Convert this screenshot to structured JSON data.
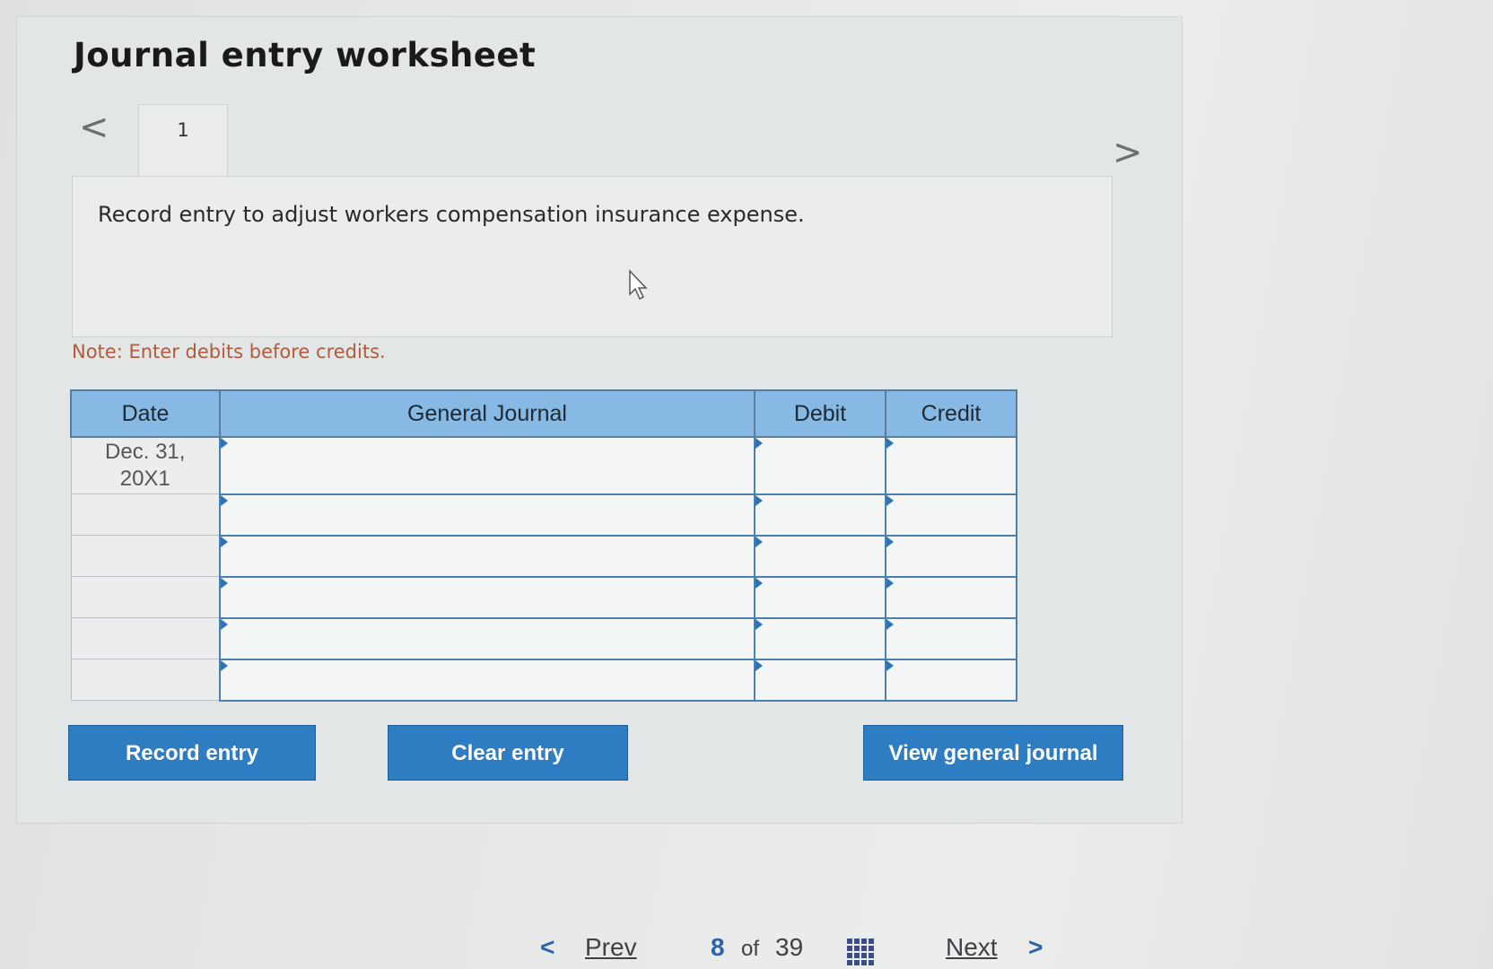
{
  "worksheet": {
    "title": "Journal entry worksheet",
    "prev_arrow": "<",
    "next_arrow": ">",
    "tabs": [
      {
        "label": "1"
      }
    ],
    "instruction": "Record entry to adjust workers compensation insurance expense.",
    "note": "Note: Enter debits before credits."
  },
  "journal_table": {
    "headers": {
      "date": "Date",
      "general_journal": "General Journal",
      "debit": "Debit",
      "credit": "Credit"
    },
    "rows": [
      {
        "date": "Dec. 31,\n20X1",
        "account": "",
        "debit": "",
        "credit": ""
      },
      {
        "date": "",
        "account": "",
        "debit": "",
        "credit": ""
      },
      {
        "date": "",
        "account": "",
        "debit": "",
        "credit": ""
      },
      {
        "date": "",
        "account": "",
        "debit": "",
        "credit": ""
      },
      {
        "date": "",
        "account": "",
        "debit": "",
        "credit": ""
      },
      {
        "date": "",
        "account": "",
        "debit": "",
        "credit": ""
      }
    ]
  },
  "buttons": {
    "record_entry": "Record entry",
    "clear_entry": "Clear entry",
    "view_general_journal": "View general journal"
  },
  "footer": {
    "prev_icon": "<",
    "prev_label": "Prev",
    "current_page": "8",
    "of_label": "of",
    "total_pages": "39",
    "next_label": "Next",
    "next_icon": ">"
  },
  "colors": {
    "header_blue": "#86b9e4",
    "button_blue": "#2e7cc2",
    "note_color": "#b15a3c"
  }
}
